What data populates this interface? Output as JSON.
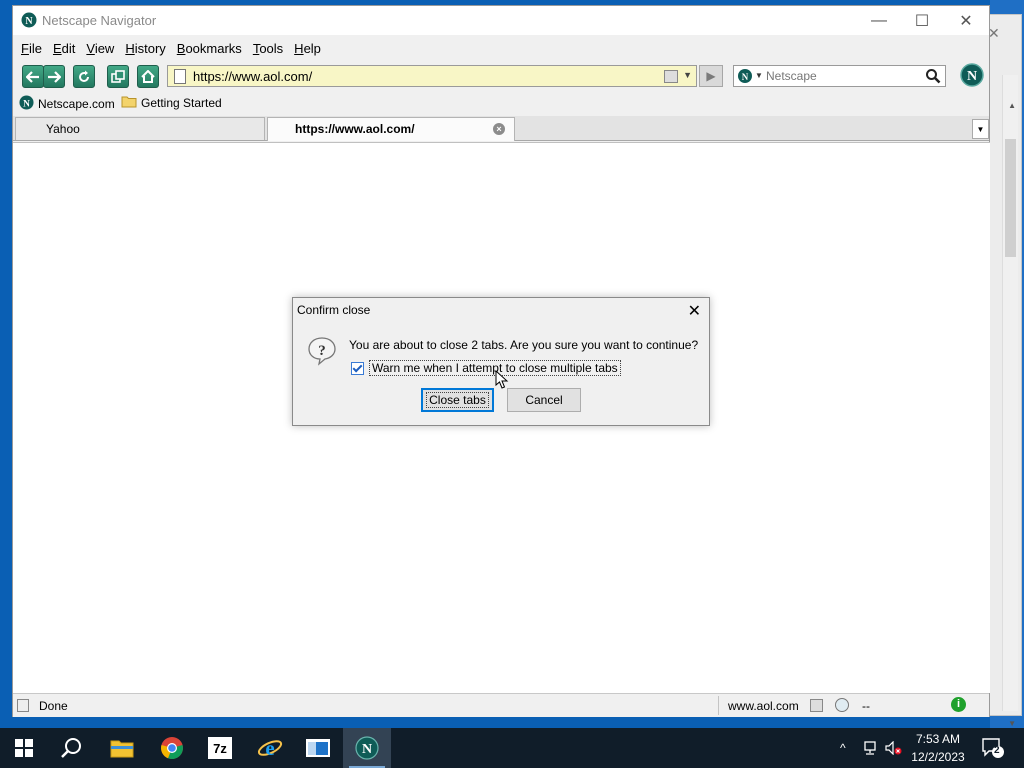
{
  "window": {
    "title": "Netscape Navigator"
  },
  "menu": [
    "File",
    "Edit",
    "View",
    "History",
    "Bookmarks",
    "Tools",
    "Help"
  ],
  "navbar": {
    "url": "https://www.aol.com/",
    "search_placeholder": "Netscape"
  },
  "bookmarks": [
    {
      "label": "Netscape.com",
      "icon": "netscape-icon"
    },
    {
      "label": "Getting Started",
      "icon": "folder-icon"
    }
  ],
  "tabs": [
    {
      "label": "Yahoo",
      "active": false
    },
    {
      "label": "https://www.aol.com/",
      "active": true
    }
  ],
  "status": {
    "text": "Done",
    "domain": "www.aol.com",
    "extra": "--"
  },
  "dialog": {
    "title": "Confirm close",
    "message": "You are about to close 2 tabs. Are you sure you want to continue?",
    "checkbox_label": "Warn me when I attempt to close multiple tabs",
    "checkbox_checked": true,
    "ok_label": "Close tabs",
    "cancel_label": "Cancel"
  },
  "taskbar": {
    "apps": [
      "start",
      "search",
      "file-explorer",
      "chrome",
      "7zip",
      "internet-explorer",
      "app-window",
      "netscape"
    ],
    "time": "7:53 AM",
    "date": "12/2/2023",
    "notification_count": "2"
  },
  "colors": {
    "desktop": "#0a5fb4",
    "taskbar": "#101d29",
    "url_bg": "#f8f6c6",
    "nav_button": "#2f8f72",
    "dialog_focus": "#0078d7"
  }
}
